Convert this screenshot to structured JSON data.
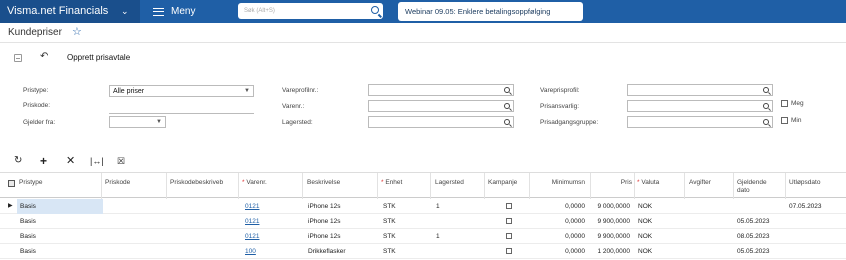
{
  "topbar": {
    "brand": "Visma.net Financials",
    "menu_label": "Meny",
    "search_placeholder": "Søk (Alt+S)",
    "banner": "Webinar 09.05: Enklere betalingsoppfølging"
  },
  "page": {
    "title": "Kundepriser"
  },
  "toolbar": {
    "create_label": "Opprett prisavtale"
  },
  "filters": {
    "pristype_label": "Pristype:",
    "pristype_value": "Alle priser",
    "priskode_label": "Priskode:",
    "gjelder_fra_label": "Gjelder fra:",
    "vareprofilnr_label": "Vareprofilnr.:",
    "varenr_label": "Varenr.:",
    "lagersted_label": "Lagersted:",
    "vareprisprofil_label": "Vareprisprofil:",
    "prisansvarlig_label": "Prisansvarlig:",
    "prisadgangsgruppe_label": "Prisadgangsgruppe:",
    "meg_label": "Meg",
    "min_label": "Min"
  },
  "grid": {
    "columns": {
      "pristype": "Pristype",
      "priskode": "Priskode",
      "priskodebeskrivelse": "Priskodebeskriveb",
      "varenr": "Varenr.",
      "beskrivelse": "Beskrivelse",
      "enhet": "Enhet",
      "lagersted": "Lagersted",
      "kampanje": "Kampanje",
      "minimumsn": "Minimumsn",
      "pris": "Pris",
      "valuta": "Valuta",
      "avgifter": "Avgifter",
      "gjeldende_dato": "Gjeldende dato",
      "utlopsdato": "Utløpsdato"
    },
    "rows": [
      {
        "pristype": "Basis",
        "varenr": "0121",
        "beskrivelse": "iPhone 12s",
        "enhet": "STK",
        "lagersted": "1",
        "minimumsn": "0,0000",
        "pris": "9 000,0000",
        "valuta": "NOK",
        "gjeldende_dato": "",
        "utlopsdato": "07.05.2023"
      },
      {
        "pristype": "Basis",
        "varenr": "0121",
        "beskrivelse": "iPhone 12s",
        "enhet": "STK",
        "lagersted": "",
        "minimumsn": "0,0000",
        "pris": "9 900,0000",
        "valuta": "NOK",
        "gjeldende_dato": "05.05.2023",
        "utlopsdato": ""
      },
      {
        "pristype": "Basis",
        "varenr": "0121",
        "beskrivelse": "iPhone 12s",
        "enhet": "STK",
        "lagersted": "1",
        "minimumsn": "0,0000",
        "pris": "9 900,0000",
        "valuta": "NOK",
        "gjeldende_dato": "08.05.2023",
        "utlopsdato": ""
      },
      {
        "pristype": "Basis",
        "varenr": "100",
        "beskrivelse": "Drikkeflasker",
        "enhet": "STK",
        "lagersted": "",
        "minimumsn": "0,0000",
        "pris": "1 200,0000",
        "valuta": "NOK",
        "gjeldende_dato": "05.05.2023",
        "utlopsdato": ""
      }
    ]
  }
}
